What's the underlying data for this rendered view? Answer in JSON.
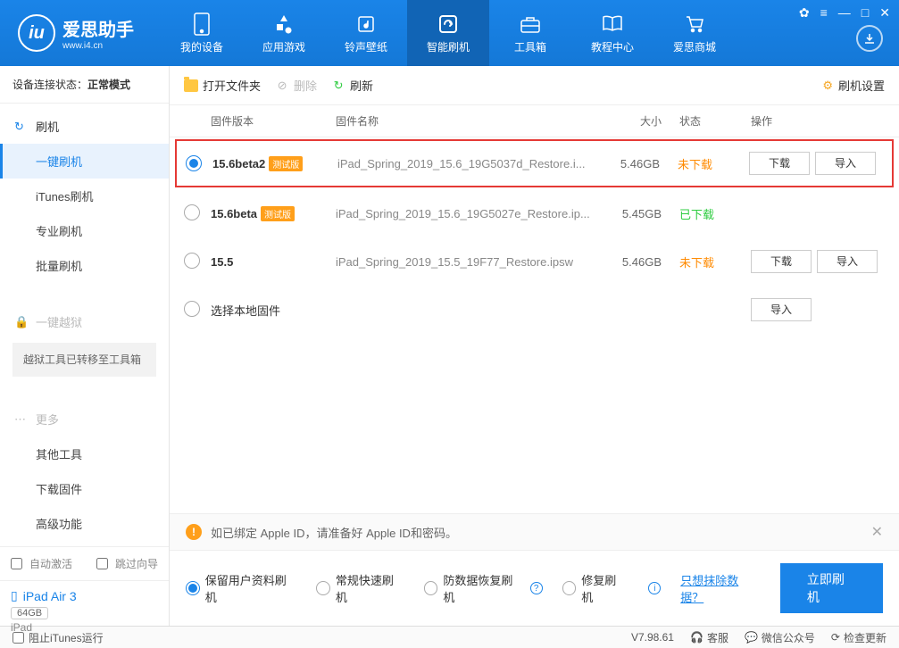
{
  "app": {
    "name": "爱思助手",
    "site": "www.i4.cn"
  },
  "nav": [
    {
      "label": "我的设备"
    },
    {
      "label": "应用游戏"
    },
    {
      "label": "铃声壁纸"
    },
    {
      "label": "智能刷机"
    },
    {
      "label": "工具箱"
    },
    {
      "label": "教程中心"
    },
    {
      "label": "爱思商城"
    }
  ],
  "sidebar": {
    "status_label": "设备连接状态：",
    "status_value": "正常模式",
    "g1": {
      "header": "刷机",
      "items": [
        "一键刷机",
        "iTunes刷机",
        "专业刷机",
        "批量刷机"
      ]
    },
    "g2": {
      "header": "一键越狱",
      "note": "越狱工具已转移至工具箱"
    },
    "g3": {
      "header": "更多",
      "items": [
        "其他工具",
        "下载固件",
        "高级功能"
      ]
    },
    "auto_activate": "自动激活",
    "skip_guide": "跳过向导",
    "device": {
      "name": "iPad Air 3",
      "storage": "64GB",
      "model": "iPad"
    }
  },
  "toolbar": {
    "open": "打开文件夹",
    "del": "删除",
    "refresh": "刷新",
    "settings": "刷机设置"
  },
  "thead": {
    "ver": "固件版本",
    "name": "固件名称",
    "size": "大小",
    "status": "状态",
    "ops": "操作"
  },
  "rows": [
    {
      "ver": "15.6beta2",
      "beta": "测试版",
      "name": "iPad_Spring_2019_15.6_19G5037d_Restore.i...",
      "size": "5.46GB",
      "status": "未下载",
      "status_cls": "no",
      "ops": true,
      "sel": true
    },
    {
      "ver": "15.6beta",
      "beta": "测试版",
      "name": "iPad_Spring_2019_15.6_19G5027e_Restore.ip...",
      "size": "5.45GB",
      "status": "已下载",
      "status_cls": "yes",
      "ops": false,
      "sel": false
    },
    {
      "ver": "15.5",
      "beta": "",
      "name": "iPad_Spring_2019_15.5_19F77_Restore.ipsw",
      "size": "5.46GB",
      "status": "未下载",
      "status_cls": "no",
      "ops": true,
      "sel": false
    }
  ],
  "local_row": {
    "label": "选择本地固件",
    "import": "导入"
  },
  "btn": {
    "download": "下载",
    "import": "导入"
  },
  "alert": "如已绑定 Apple ID，请准备好 Apple ID和密码。",
  "options": [
    "保留用户资料刷机",
    "常规快速刷机",
    "防数据恢复刷机",
    "修复刷机"
  ],
  "erase_link": "只想抹除数据？",
  "flash_btn": "立即刷机",
  "footer": {
    "block_itunes": "阻止iTunes运行",
    "version": "V7.98.61",
    "support": "客服",
    "wechat": "微信公众号",
    "update": "检查更新"
  }
}
